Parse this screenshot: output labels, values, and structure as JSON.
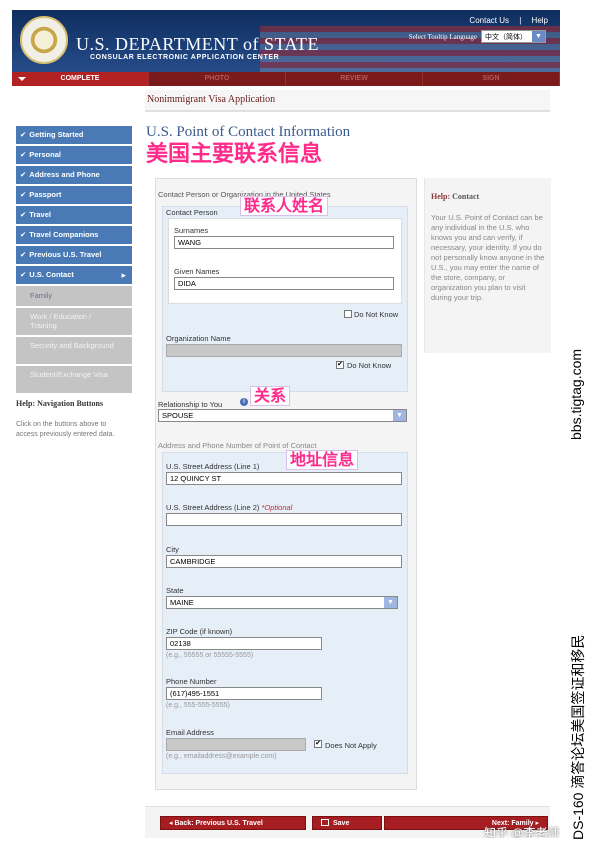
{
  "header": {
    "contact_link": "Contact Us",
    "separator": "|",
    "help_link": "Help",
    "dept_title": "U.S. DEPARTMENT of STATE",
    "dept_subtitle": "CONSULAR ELECTRONIC APPLICATION CENTER",
    "language_label": "Select Tooltip Language",
    "language_value": "中文（简体）"
  },
  "progress": [
    "COMPLETE",
    "PHOTO",
    "REVIEW",
    "SIGN"
  ],
  "breadcrumb": "Nonimmigrant Visa Application",
  "sidebar": {
    "items": [
      {
        "label": "Getting Started"
      },
      {
        "label": "Personal"
      },
      {
        "label": "Address and Phone"
      },
      {
        "label": "Passport"
      },
      {
        "label": "Travel"
      },
      {
        "label": "Travel Companions"
      },
      {
        "label": "Previous U.S. Travel"
      },
      {
        "label": "U.S. Contact"
      }
    ],
    "sub_items": [
      "Family",
      "Work / Education / Training",
      "Security and Background",
      "Student/Exchange Visa"
    ],
    "help_title": "Help: Navigation Buttons",
    "help_text": "Click on the buttons above to access previously entered data."
  },
  "main": {
    "title": "U.S. Point of Contact Information",
    "annotation_title": "美国主要联系信息",
    "panel_caption": "Contact Person or Organization in the United States",
    "contact_person_label": "Contact Person",
    "annotation_name": "联系人姓名",
    "surnames_label": "Surnames",
    "surnames_value": "WANG",
    "given_names_label": "Given Names",
    "given_names_value": "DIDA",
    "do_not_know_1": "Do Not Know",
    "org_name_label": "Organization Name",
    "do_not_know_2": "Do Not Know",
    "relationship_label": "Relationship to You",
    "annotation_relationship": "关系",
    "relationship_value": "SPOUSE",
    "address_caption": "Address and Phone Number of Point of Contact",
    "annotation_address": "地址信息",
    "street1_label": "U.S. Street Address (Line 1)",
    "street1_value": "12 QUINCY ST",
    "street2_label": "U.S. Street Address (Line 2)",
    "street2_optional": "*Optional",
    "street2_value": "",
    "city_label": "City",
    "city_value": "CAMBRIDGE",
    "state_label": "State",
    "state_value": "MAINE",
    "zip_label": "ZIP Code (if known)",
    "zip_value": "02138",
    "zip_hint": "(e.g., 55555 or 55555-5555)",
    "phone_label": "Phone Number",
    "phone_value": "(617)495-1551",
    "phone_hint": "(e.g., 555-555-5555)",
    "email_label": "Email Address",
    "email_value": "",
    "email_does_not_apply": "Does Not Apply",
    "email_hint": "(e.g., emailaddress@example.com)"
  },
  "help_panel": {
    "title_prefix": "Help:",
    "title_topic": "Contact",
    "text": "Your U.S. Point of Contact can be any individual in the U.S. who knows you and can verify, if necessary, your identity. If you do not personally know anyone in the U.S., you may enter the name of the store, company, or organization you plan to visit during your trip."
  },
  "bottom": {
    "back_label": "Back: Previous U.S. Travel",
    "save_label": "Save",
    "next_label": "Next: Family"
  },
  "watermarks": {
    "side_url": "bbs.tigtag.com",
    "side_text": "DS-160 滴答论坛美国签证和移民",
    "zhihu": "知乎 @李老师"
  }
}
